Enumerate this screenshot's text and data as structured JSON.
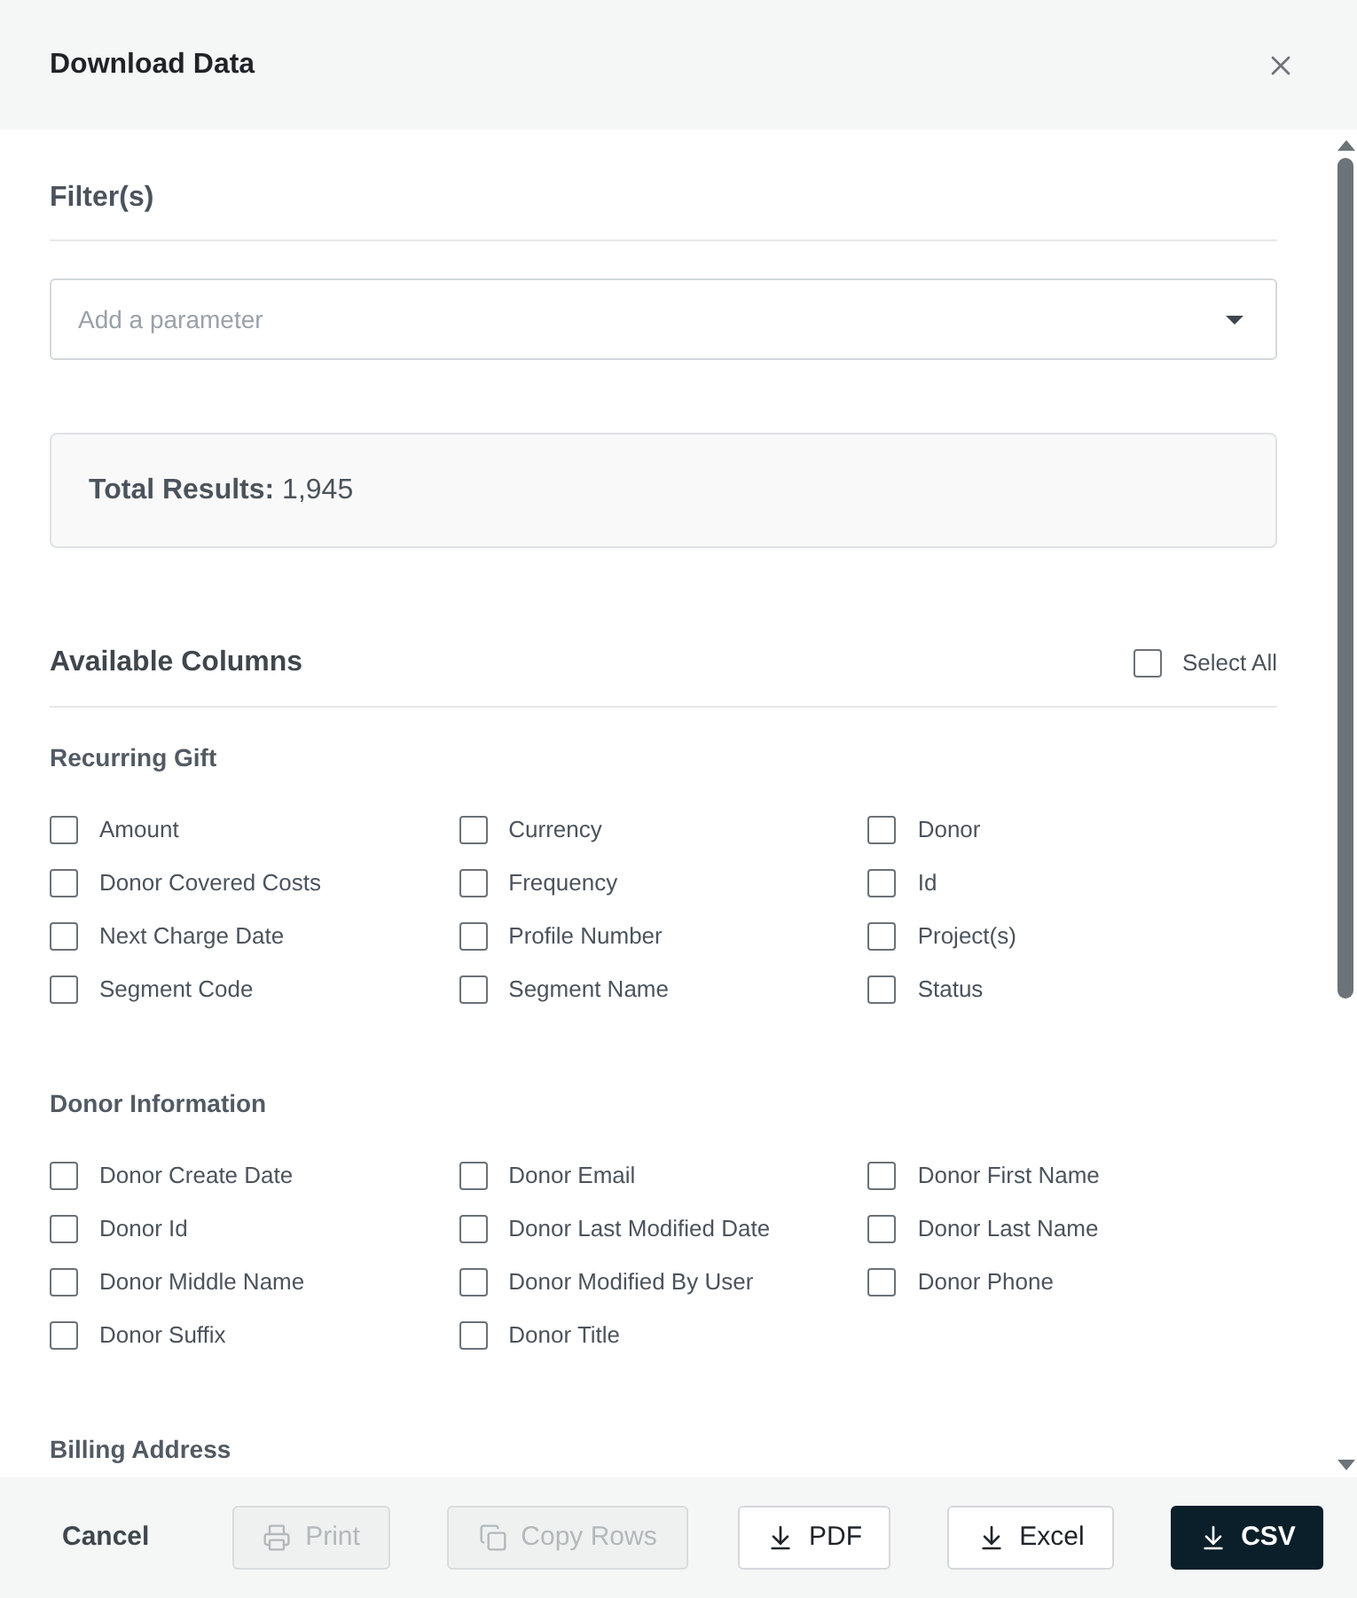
{
  "dialog": {
    "title": "Download Data"
  },
  "filters": {
    "heading": "Filter(s)",
    "parameter_select": {
      "placeholder": "Add a parameter"
    }
  },
  "total_results": "**Total Results:** 1,945",
  "available_columns": {
    "heading": "Available Columns",
    "select_all": {
      "label": "Select All",
      "checked": false
    }
  },
  "groups": [
    {
      "title": "Recurring Gift",
      "columns": [
        {
          "label": "Amount",
          "checked": false
        },
        {
          "label": "Currency",
          "checked": false
        },
        {
          "label": "Donor",
          "checked": false
        },
        {
          "label": "Donor Covered Costs",
          "checked": false
        },
        {
          "label": "Frequency",
          "checked": false
        },
        {
          "label": "Id",
          "checked": false
        },
        {
          "label": "Next Charge Date",
          "checked": false
        },
        {
          "label": "Profile Number",
          "checked": false
        },
        {
          "label": "Project(s)",
          "checked": false
        },
        {
          "label": "Segment Code",
          "checked": false
        },
        {
          "label": "Segment Name",
          "checked": false
        },
        {
          "label": "Status",
          "checked": false
        }
      ]
    },
    {
      "title": "Donor Information",
      "columns": [
        {
          "label": "Donor Create Date",
          "checked": false
        },
        {
          "label": "Donor Email",
          "checked": false
        },
        {
          "label": "Donor First Name",
          "checked": false
        },
        {
          "label": "Donor Id",
          "checked": false
        },
        {
          "label": "Donor Last Modified Date",
          "checked": false
        },
        {
          "label": "Donor Last Name",
          "checked": false
        },
        {
          "label": "Donor Middle Name",
          "checked": false
        },
        {
          "label": "Donor Modified By User",
          "checked": false
        },
        {
          "label": "Donor Phone",
          "checked": false
        },
        {
          "label": "Donor Suffix",
          "checked": false
        },
        {
          "label": "Donor Title",
          "checked": false
        }
      ]
    },
    {
      "title": "Billing Address"
    }
  ],
  "footer": {
    "buttons": [
      {
        "label": "Cancel",
        "kind": "cancel",
        "disabled": false,
        "primary": false
      },
      {
        "label": "Print",
        "kind": "print",
        "disabled": true,
        "primary": false
      },
      {
        "label": "Copy Rows",
        "kind": "copy",
        "disabled": true,
        "primary": false
      },
      {
        "label": "PDF",
        "kind": "download",
        "disabled": false,
        "primary": false
      },
      {
        "label": "Excel",
        "kind": "download",
        "disabled": false,
        "primary": false
      },
      {
        "label": "CSV",
        "kind": "download",
        "disabled": false,
        "primary": true
      }
    ]
  }
}
